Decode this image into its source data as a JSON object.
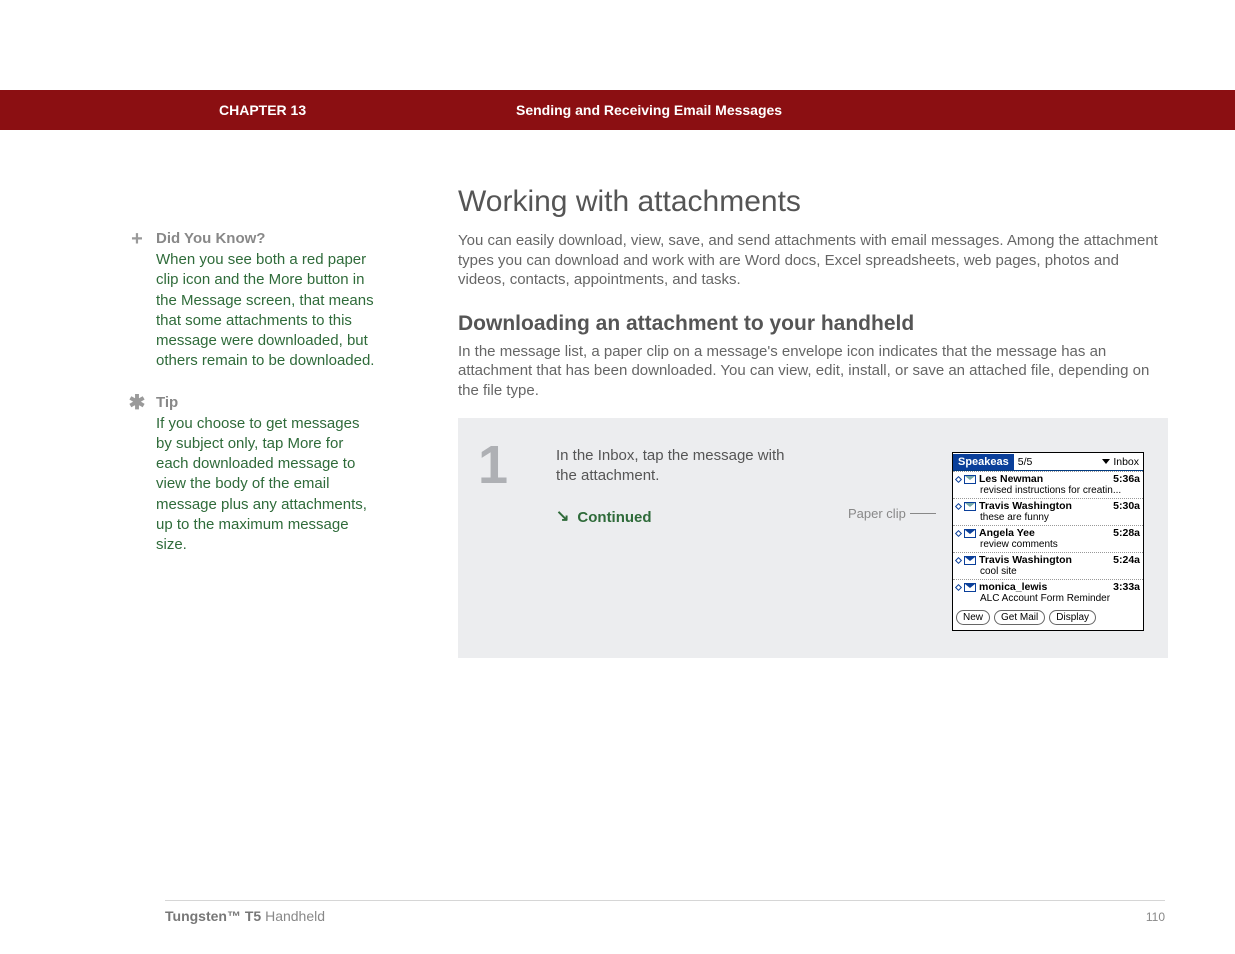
{
  "header": {
    "chapter": "CHAPTER 13",
    "title": "Sending and Receiving Email Messages"
  },
  "sidebar": {
    "dyk_label": "Did You Know?",
    "dyk_body": "When you see both a red paper clip icon and the More button in the Message screen, that means that some attachments to this message were downloaded, but others remain to be downloaded.",
    "tip_label": "Tip",
    "tip_body": "If you choose to get messages by subject only, tap More for each downloaded message to view the body of the email message plus any attachments, up to the maximum message size."
  },
  "main": {
    "h1": "Working with attachments",
    "intro": "You can easily download, view, save, and send attachments with email messages. Among the attachment types you can download and work with are Word docs, Excel spreadsheets, web pages, photos and videos, contacts, appointments, and tasks.",
    "h2": "Downloading an attachment to your handheld",
    "desc": "In the message list, a paper clip on a message's envelope icon indicates that the message has an attachment that has been downloaded. You can view, edit, install, or save an attached file, depending on the file type.",
    "step_num": "1",
    "step_text": "In the Inbox, tap the message with the attachment.",
    "continued": "Continued",
    "callout": "Paper clip"
  },
  "device": {
    "app": "Speakeas",
    "count": "5/5",
    "folder": "Inbox",
    "rows": [
      {
        "sender": "Les Newman",
        "time": "5:36a",
        "subject": "revised instructions for creatin...",
        "attach": true
      },
      {
        "sender": "Travis Washington",
        "time": "5:30a",
        "subject": "these are funny",
        "attach": true
      },
      {
        "sender": "Angela Yee",
        "time": "5:28a",
        "subject": "review comments",
        "attach": false
      },
      {
        "sender": "Travis Washington",
        "time": "5:24a",
        "subject": "cool site",
        "attach": false
      },
      {
        "sender": "monica_lewis",
        "time": "3:33a",
        "subject": "ALC Account Form Reminder",
        "attach": false
      }
    ],
    "buttons": {
      "new": "New",
      "get": "Get Mail",
      "display": "Display"
    }
  },
  "footer": {
    "product_bold": "Tungsten™ T5",
    "product_rest": " Handheld",
    "page": "110"
  }
}
